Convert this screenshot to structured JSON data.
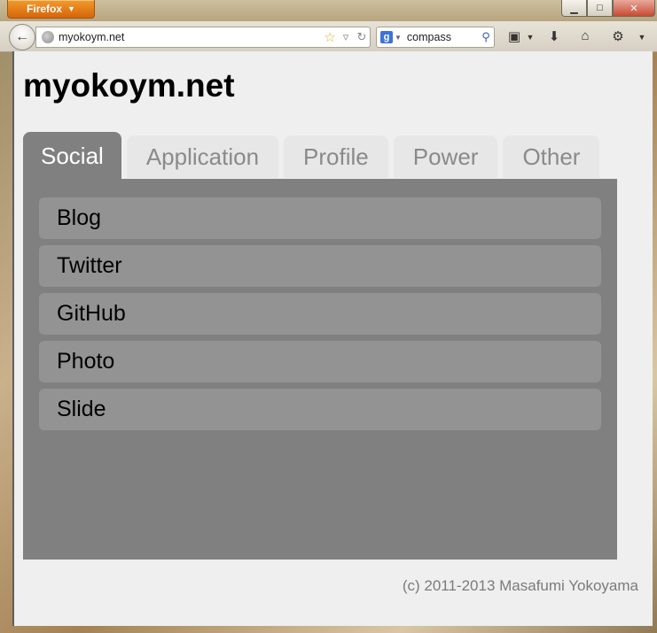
{
  "browser": {
    "app_button": "Firefox",
    "url": "myokoym.net",
    "search_engine_icon": "google-icon",
    "search_query": "compass",
    "window_controls": [
      "minimize",
      "maximize",
      "close"
    ]
  },
  "page": {
    "site_title": "myokoym.net",
    "tabs": [
      {
        "label": "Social",
        "active": true
      },
      {
        "label": "Application",
        "active": false
      },
      {
        "label": "Profile",
        "active": false
      },
      {
        "label": "Power",
        "active": false
      },
      {
        "label": "Other",
        "active": false
      }
    ],
    "menu_items": [
      {
        "label": "Blog"
      },
      {
        "label": "Twitter"
      },
      {
        "label": "GitHub"
      },
      {
        "label": "Photo"
      },
      {
        "label": "Slide"
      }
    ],
    "footer": "(c) 2011-2013 Masafumi Yokoyama"
  },
  "colors": {
    "active_tab": "#808080",
    "inactive_tab": "#e7e7e7",
    "panel": "#808080",
    "menu_item": "#939393",
    "firefox_button": "#e6821c"
  }
}
